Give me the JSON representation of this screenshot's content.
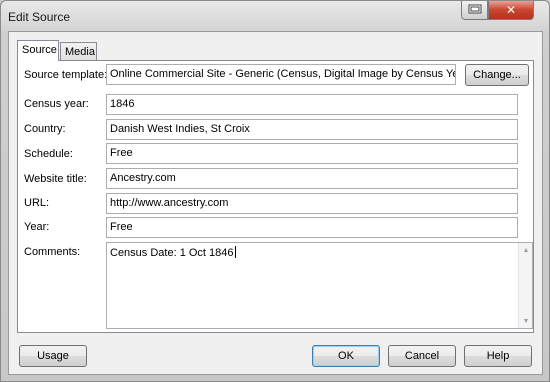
{
  "window": {
    "title": "Edit Source"
  },
  "titlebar_buttons": {
    "close_glyph": "✕"
  },
  "tabs": [
    {
      "label": "Source",
      "active": true
    },
    {
      "label": "Media",
      "active": false
    }
  ],
  "form": {
    "source_template": {
      "label": "Source template:",
      "value": "Online Commercial Site - Generic (Census, Digital Image by Census Year)",
      "button": "Change..."
    },
    "census_year": {
      "label": "Census year:",
      "value": "1846"
    },
    "country": {
      "label": "Country:",
      "value": "Danish West Indies, St Croix"
    },
    "schedule": {
      "label": "Schedule:",
      "value": "Free"
    },
    "website_title": {
      "label": "Website title:",
      "value": "Ancestry.com"
    },
    "url": {
      "label": "URL:",
      "value": "http://www.ancestry.com"
    },
    "year": {
      "label": "Year:",
      "value": "Free"
    },
    "comments": {
      "label": "Comments:",
      "value": "Census Date: 1 Oct 1846"
    }
  },
  "buttons": {
    "usage": "Usage",
    "ok": "OK",
    "cancel": "Cancel",
    "help": "Help"
  },
  "icons": {
    "minimize": "window-restore-icon",
    "close": "close-icon",
    "scroll_up": "scroll-up-arrow-icon",
    "scroll_down": "scroll-down-arrow-icon"
  }
}
